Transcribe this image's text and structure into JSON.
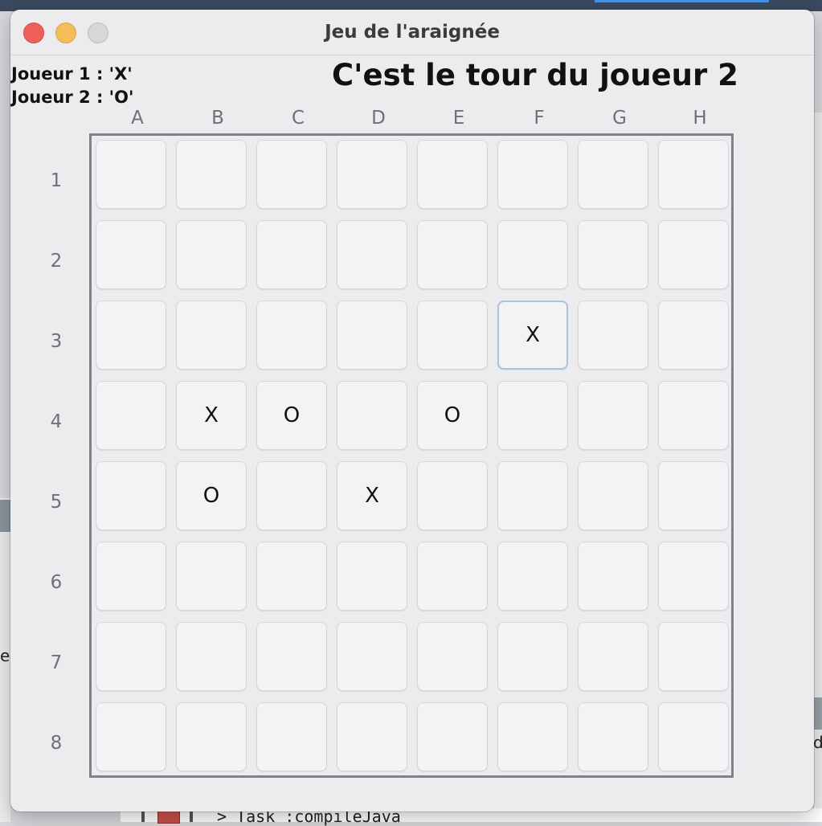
{
  "window": {
    "title": "Jeu de l'araignée"
  },
  "players": {
    "p1": "Joueur 1 : 'X'",
    "p2": "Joueur 2 : 'O'"
  },
  "status": "C'est le tour du joueur 2",
  "columns": [
    "A",
    "B",
    "C",
    "D",
    "E",
    "F",
    "G",
    "H"
  ],
  "rows": [
    "1",
    "2",
    "3",
    "4",
    "5",
    "6",
    "7",
    "8"
  ],
  "board": [
    [
      "",
      "",
      "",
      "",
      "",
      "",
      "",
      ""
    ],
    [
      "",
      "",
      "",
      "",
      "",
      "",
      "",
      ""
    ],
    [
      "",
      "",
      "",
      "",
      "",
      "X",
      "",
      ""
    ],
    [
      "",
      "X",
      "O",
      "",
      "O",
      "",
      "",
      ""
    ],
    [
      "",
      "O",
      "",
      "X",
      "",
      "",
      "",
      ""
    ],
    [
      "",
      "",
      "",
      "",
      "",
      "",
      "",
      ""
    ],
    [
      "",
      "",
      "",
      "",
      "",
      "",
      "",
      ""
    ],
    [
      "",
      "",
      "",
      "",
      "",
      "",
      "",
      ""
    ]
  ],
  "focused_cell": "F3",
  "background": {
    "bottom_text": "> Task :compileJava",
    "left_char": "e",
    "right_char": "d"
  }
}
